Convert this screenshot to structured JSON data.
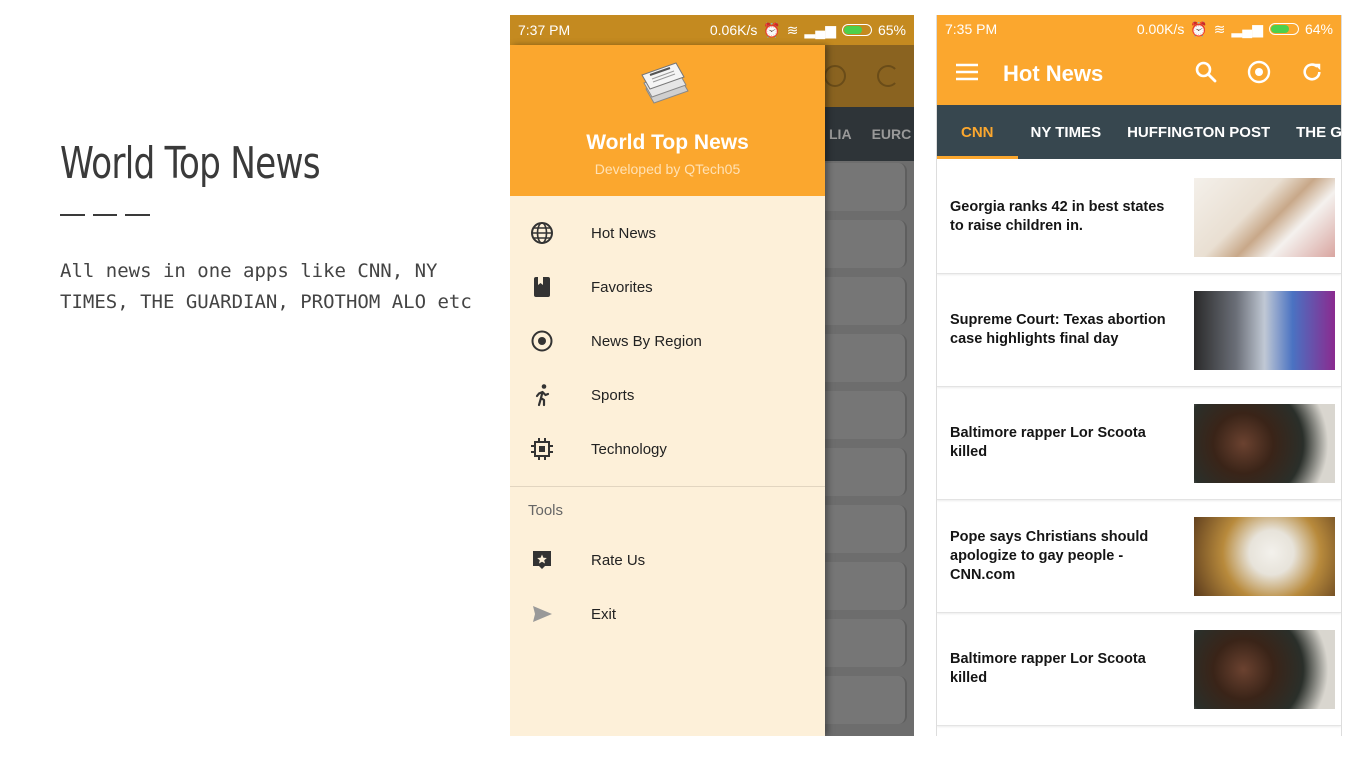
{
  "slide": {
    "title": "World Top News",
    "description": "All news in one apps like CNN, NY TIMES, THE GUARDIAN, PROTHOM ALO etc"
  },
  "phone1": {
    "status": {
      "time": "7:37 PM",
      "speed": "0.06K/s",
      "battery": "65%",
      "battery_level": 0.65
    },
    "background_tabs": [
      "LIA",
      "EURC"
    ],
    "drawer": {
      "app_title": "World Top News",
      "developer": "Developed by QTech05",
      "logo_icon": "newspaper-icon",
      "menu": [
        {
          "label": "Hot News",
          "icon": "globe-icon"
        },
        {
          "label": "Favorites",
          "icon": "bookmark-icon"
        },
        {
          "label": "News By Region",
          "icon": "radio-target-icon"
        },
        {
          "label": "Sports",
          "icon": "running-person-icon"
        },
        {
          "label": "Technology",
          "icon": "chip-icon"
        }
      ],
      "tools_header": "Tools",
      "tools": [
        {
          "label": "Rate Us",
          "icon": "rate-star-icon"
        },
        {
          "label": "Exit",
          "icon": "send-arrow-icon"
        }
      ]
    }
  },
  "phone2": {
    "status": {
      "time": "7:35 PM",
      "speed": "0.00K/s",
      "battery": "64%",
      "battery_level": 0.64
    },
    "appbar": {
      "title": "Hot News",
      "icons": [
        "menu-icon",
        "search-icon",
        "target-icon",
        "refresh-icon"
      ]
    },
    "tabs": [
      {
        "label": "CNN",
        "active": true
      },
      {
        "label": "NY TIMES",
        "active": false
      },
      {
        "label": "HUFFINGTON POST",
        "active": false
      },
      {
        "label": "THE G",
        "active": false
      }
    ],
    "articles": [
      {
        "title": "Georgia ranks 42 in best states to raise children in."
      },
      {
        "title": "Supreme Court: Texas abortion case highlights final day"
      },
      {
        "title": "Baltimore rapper Lor Scoota killed"
      },
      {
        "title": "Pope says Christians should apologize to gay people - CNN.com"
      },
      {
        "title": "Baltimore rapper Lor Scoota killed"
      }
    ]
  },
  "colors": {
    "accent_orange": "#fba72e",
    "tab_bar": "#37474f",
    "drawer_bg": "#fdf0d9"
  }
}
